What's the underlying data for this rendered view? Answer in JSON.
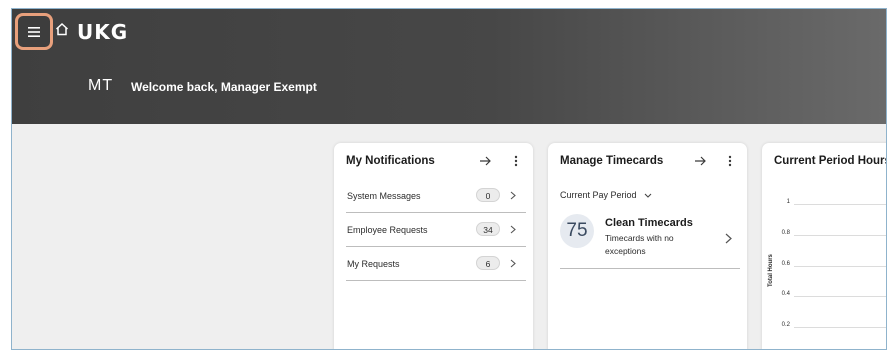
{
  "header": {
    "brand": "UKG",
    "avatar_initials": "MT",
    "welcome": "Welcome back, Manager Exempt"
  },
  "icons": [
    "hamburger-menu-icon",
    "home-icon",
    "arrow-right-icon",
    "kebab-menu-icon",
    "chevron-right-icon",
    "chevron-down-icon"
  ],
  "colors": {
    "menu_highlight": "#e8a07c",
    "header_bg": "#474747"
  },
  "notifications": {
    "title": "My Notifications",
    "items": [
      {
        "label": "System Messages",
        "count": "0"
      },
      {
        "label": "Employee Requests",
        "count": "34"
      },
      {
        "label": "My Requests",
        "count": "6"
      }
    ]
  },
  "timecards": {
    "title": "Manage Timecards",
    "period": "Current Pay Period",
    "count": "75",
    "status_title": "Clean Timecards",
    "status_desc": "Timecards with no exceptions"
  },
  "period_hours": {
    "title": "Current Period Hours",
    "chart_data": {
      "type": "bar",
      "ylabel": "Total Hours",
      "yticks": [
        "1",
        "0.8",
        "0.6",
        "0.4",
        "0.2"
      ]
    }
  }
}
